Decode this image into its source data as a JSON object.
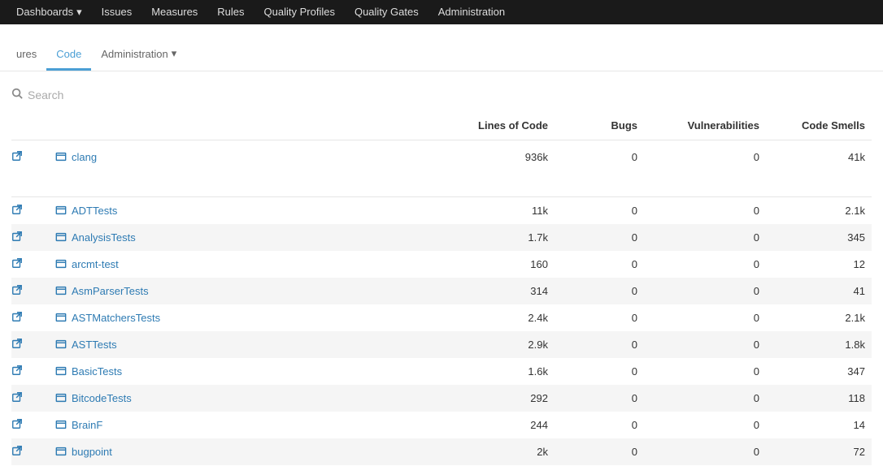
{
  "topnav": {
    "dashboards": "Dashboards",
    "issues": "Issues",
    "measures": "Measures",
    "rules": "Rules",
    "quality_profiles": "Quality Profiles",
    "quality_gates": "Quality Gates",
    "administration": "Administration"
  },
  "subnav": {
    "measures_suffix": "ures",
    "code": "Code",
    "administration": "Administration"
  },
  "search": {
    "placeholder": "Search"
  },
  "columns": {
    "name": "",
    "loc": "Lines of Code",
    "bugs": "Bugs",
    "vuln": "Vulnerabilities",
    "smells": "Code Smells"
  },
  "root": {
    "name": "clang",
    "loc": "936k",
    "bugs": "0",
    "vuln": "0",
    "smells": "41k"
  },
  "rows": [
    {
      "name": "ADTTests",
      "loc": "11k",
      "bugs": "0",
      "vuln": "0",
      "smells": "2.1k"
    },
    {
      "name": "AnalysisTests",
      "loc": "1.7k",
      "bugs": "0",
      "vuln": "0",
      "smells": "345"
    },
    {
      "name": "arcmt-test",
      "loc": "160",
      "bugs": "0",
      "vuln": "0",
      "smells": "12"
    },
    {
      "name": "AsmParserTests",
      "loc": "314",
      "bugs": "0",
      "vuln": "0",
      "smells": "41"
    },
    {
      "name": "ASTMatchersTests",
      "loc": "2.4k",
      "bugs": "0",
      "vuln": "0",
      "smells": "2.1k"
    },
    {
      "name": "ASTTests",
      "loc": "2.9k",
      "bugs": "0",
      "vuln": "0",
      "smells": "1.8k"
    },
    {
      "name": "BasicTests",
      "loc": "1.6k",
      "bugs": "0",
      "vuln": "0",
      "smells": "347"
    },
    {
      "name": "BitcodeTests",
      "loc": "292",
      "bugs": "0",
      "vuln": "0",
      "smells": "118"
    },
    {
      "name": "BrainF",
      "loc": "244",
      "bugs": "0",
      "vuln": "0",
      "smells": "14"
    },
    {
      "name": "bugpoint",
      "loc": "2k",
      "bugs": "0",
      "vuln": "0",
      "smells": "72"
    }
  ]
}
